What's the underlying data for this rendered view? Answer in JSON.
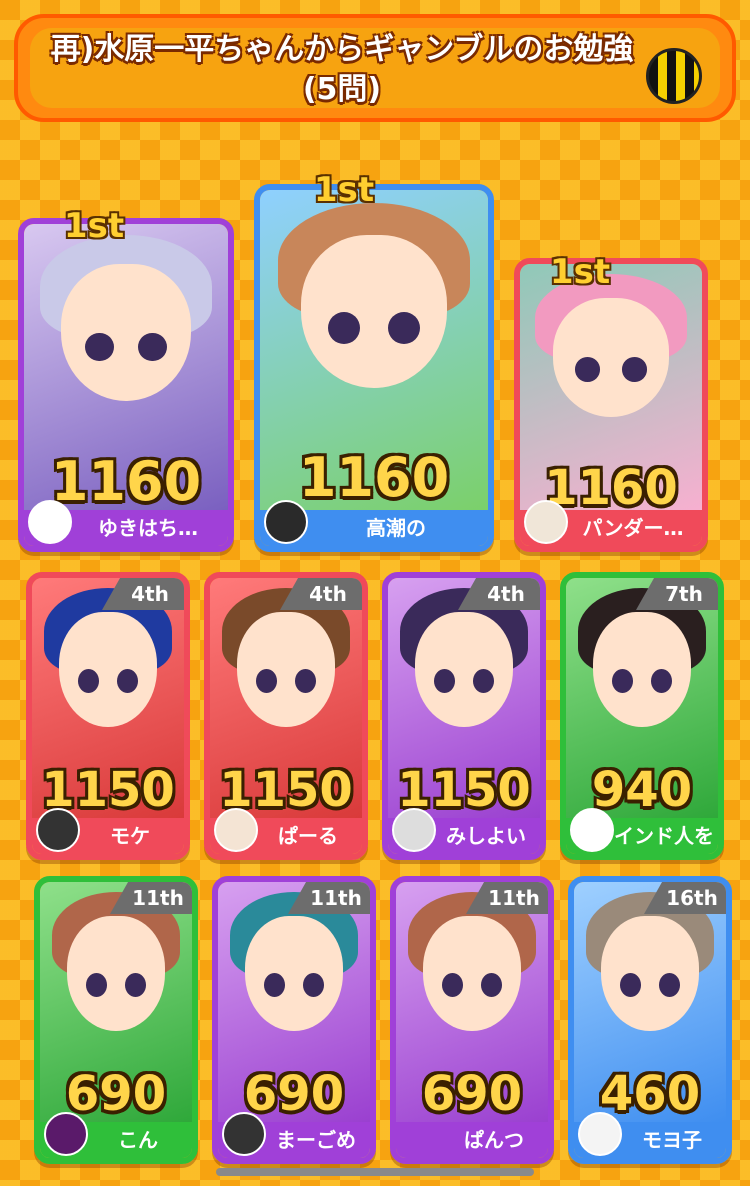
{
  "header": {
    "title": "再)水原一平ちゃんからギャンブルのお勉強(5問)",
    "menu_icon": "striped-menu-icon"
  },
  "top_players": [
    {
      "rank": "1st",
      "score": "1160",
      "name": "ゆきはち…",
      "color": "#a040d8"
    },
    {
      "rank": "1st",
      "score": "1160",
      "name": "高潮の",
      "color": "#3f8ef0"
    },
    {
      "rank": "1st",
      "score": "1160",
      "name": "パンダー…",
      "color": "#f04a5a"
    }
  ],
  "players": [
    {
      "rank": "4th",
      "score": "1150",
      "name": "モケ",
      "color": "#f04a5a"
    },
    {
      "rank": "4th",
      "score": "1150",
      "name": "ぱーる",
      "color": "#f04a5a"
    },
    {
      "rank": "4th",
      "score": "1150",
      "name": "みしよい",
      "color": "#a040d8"
    },
    {
      "rank": "7th",
      "score": "940",
      "name": "インド人を",
      "color": "#2fbf3a"
    },
    {
      "rank": "11th",
      "score": "690",
      "name": "こん",
      "color": "#2fbf3a"
    },
    {
      "rank": "11th",
      "score": "690",
      "name": "まーごめ",
      "color": "#a040d8"
    },
    {
      "rank": "11th",
      "score": "690",
      "name": "ぱんつ",
      "color": "#a040d8"
    },
    {
      "rank": "16th",
      "score": "460",
      "name": "モヨ子",
      "color": "#3f8ef0"
    }
  ]
}
